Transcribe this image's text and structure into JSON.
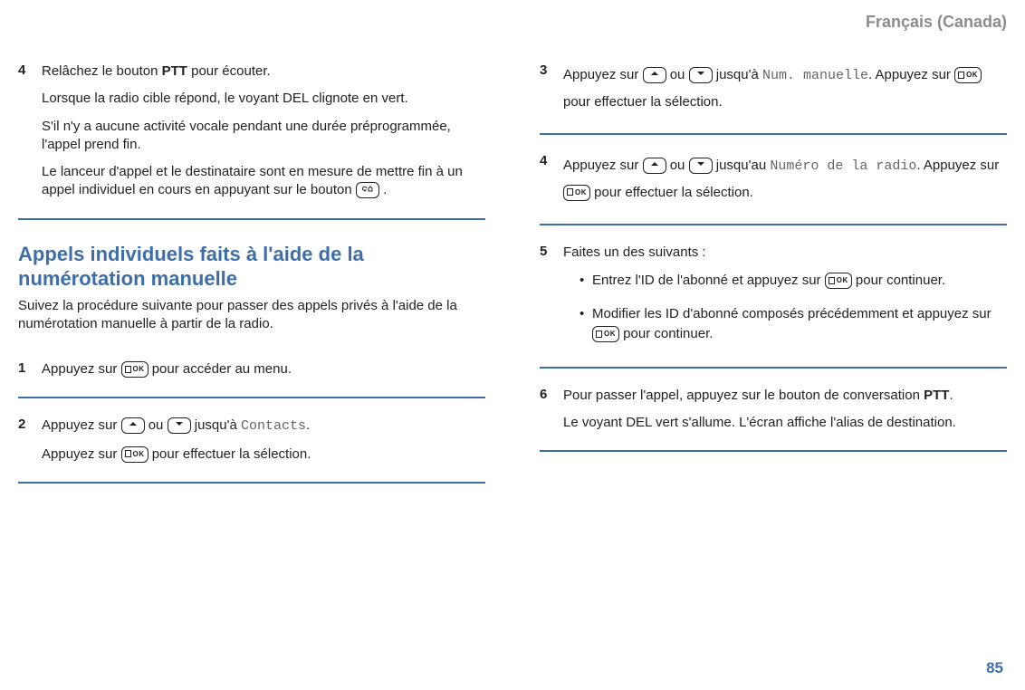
{
  "header": {
    "language": "Français (Canada)"
  },
  "left": {
    "step4": {
      "num": "4",
      "p1a": "Relâchez le bouton ",
      "p1b": "PTT",
      "p1c": " pour écouter.",
      "p2": "Lorsque la radio cible répond, le voyant DEL clignote en vert.",
      "p3": "S'il n'y a aucune activité vocale pendant une durée préprogrammée, l'appel prend fin.",
      "p4a": "Le lanceur d'appel et le destinataire sont en mesure de mettre fin à un appel individuel en cours en appuyant sur le bouton ",
      "p4b": " ."
    },
    "sectionTitle": "Appels individuels faits à l'aide de la numérotation manuelle",
    "intro": "Suivez la procédure suivante pour passer des appels privés à l'aide de la numérotation manuelle à partir de la radio.",
    "step1": {
      "num": "1",
      "a": "Appuyez sur ",
      "b": " pour accéder au menu."
    },
    "step2": {
      "num": "2",
      "a": "Appuyez sur ",
      "or": " ou ",
      "b": " jusqu'à ",
      "menu": "Contacts",
      "dot": ". ",
      "c": "Appuyez sur ",
      "d": " pour effectuer la sélection."
    }
  },
  "right": {
    "step3": {
      "num": "3",
      "a": "Appuyez sur ",
      "or": " ou ",
      "b": " jusqu'à ",
      "menu": "Num. manuelle",
      "c": ". Appuyez sur ",
      "d": " pour effectuer la sélection."
    },
    "step4": {
      "num": "4",
      "a": "Appuyez sur ",
      "or": " ou ",
      "b": " jusqu'au ",
      "menu": "Numéro de la radio",
      "c": ". Appuyez sur ",
      "d": " pour effectuer la sélection."
    },
    "step5": {
      "num": "5",
      "title": "Faites un des suivants :",
      "b1a": "Entrez l'ID de l'abonné et appuyez sur ",
      "b1b": " pour continuer.",
      "b2a": "Modifier les ID d'abonné composés précédemment et appuyez sur ",
      "b2b": " pour continuer."
    },
    "step6": {
      "num": "6",
      "p1a": "Pour passer l'appel, appuyez sur le bouton de conversation ",
      "p1b": "PTT",
      "p1c": ".",
      "p2": "Le voyant DEL vert s'allume. L'écran affiche l'alias de destination."
    }
  },
  "pageNumber": "85"
}
